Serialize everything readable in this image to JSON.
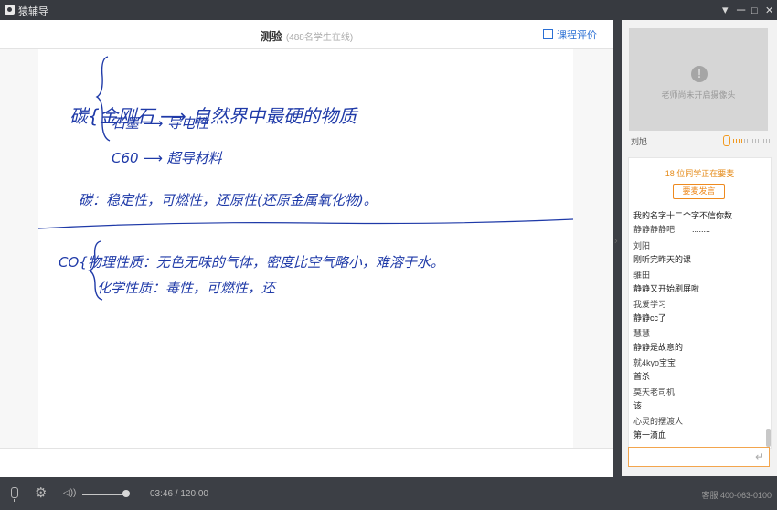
{
  "app": {
    "title": "猿辅导"
  },
  "window_controls": {
    "menu": "▾",
    "min": "─",
    "max": "□",
    "close": "✕"
  },
  "header": {
    "lesson": "测验",
    "online": "(488名学生在线)",
    "rate_label": "课程评价"
  },
  "board": {
    "lines": [
      "碳{金刚石 ⟶ 自然界中最硬的物质",
      "石墨 ⟶ 导电性",
      "C60 ⟶ 超导材料",
      "碳：稳定性，可燃性，还原性(还原金属氧化物)。",
      "CO{物理性质：无色无味的气体，密度比空气略小，难溶于水。",
      "化学性质：毒性，可燃性，还"
    ]
  },
  "camera": {
    "notice": "老师尚未开启摄像头"
  },
  "teacher": {
    "name": "刘旭"
  },
  "chat": {
    "speaking_count": "18",
    "speaking_text": "位同学正在要麦",
    "speak_button": "要麦发言",
    "first_text": "我的名字十二个字不信你数",
    "messages": [
      {
        "name": "静静静静吧",
        "text": "........"
      },
      {
        "name": "刘阳",
        "text": "刚听完昨天的课"
      },
      {
        "name": "骓田",
        "text": "静静又开始刷屏啦"
      },
      {
        "name": "我爱学习",
        "text": "静静cc了"
      },
      {
        "name": "慧慧",
        "text": "静静是故意的"
      },
      {
        "name": "就4kyo宝宝",
        "text": "首杀"
      },
      {
        "name": "莫天老司机",
        "text": "该"
      },
      {
        "name": "心灵的摆渡人",
        "text": "第一滴血"
      }
    ],
    "input_value": "",
    "send_icon": "enter-icon"
  },
  "playback": {
    "time": "03:46 / 120:00",
    "volume": 0.8
  },
  "service": {
    "text": "客服 400-063-0100"
  }
}
